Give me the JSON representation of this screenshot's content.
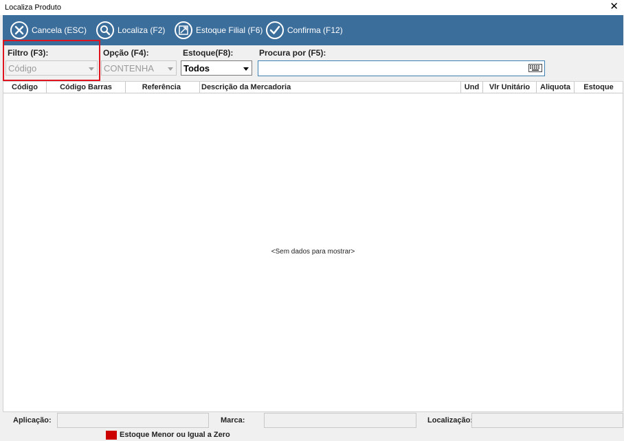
{
  "window": {
    "title": "Localiza Produto",
    "close_glyph": "✕"
  },
  "toolbar": {
    "cancel_label": "Cancela (ESC)",
    "locate_label": "Localiza (F2)",
    "stock_branch_label": "Estoque Filial (F6)",
    "confirm_label": "Confirma (F12)"
  },
  "filters": {
    "filter_label": "Filtro (F3):",
    "filter_value": "Código",
    "option_label": "Opção (F4):",
    "option_value": "CONTENHA",
    "stock_label": "Estoque(F8):",
    "stock_value": "Todos",
    "search_label": "Procura por (F5):",
    "search_value": ""
  },
  "grid": {
    "columns": [
      "Código",
      "Código Barras",
      "Referência",
      "Descrição da Mercadoria",
      "Und",
      "Vlr Unitário",
      "Aliquota",
      "Estoque"
    ],
    "empty_message": "<Sem dados para mostrar>"
  },
  "footer": {
    "application_label": "Aplicação:",
    "brand_label": "Marca:",
    "location_label": "Localização:"
  },
  "legend": {
    "label": "Estoque Menor ou Igual a Zero",
    "color": "#cc0000"
  },
  "colors": {
    "toolbar_bg": "#3c6e9c",
    "highlight": "#e0141e"
  }
}
